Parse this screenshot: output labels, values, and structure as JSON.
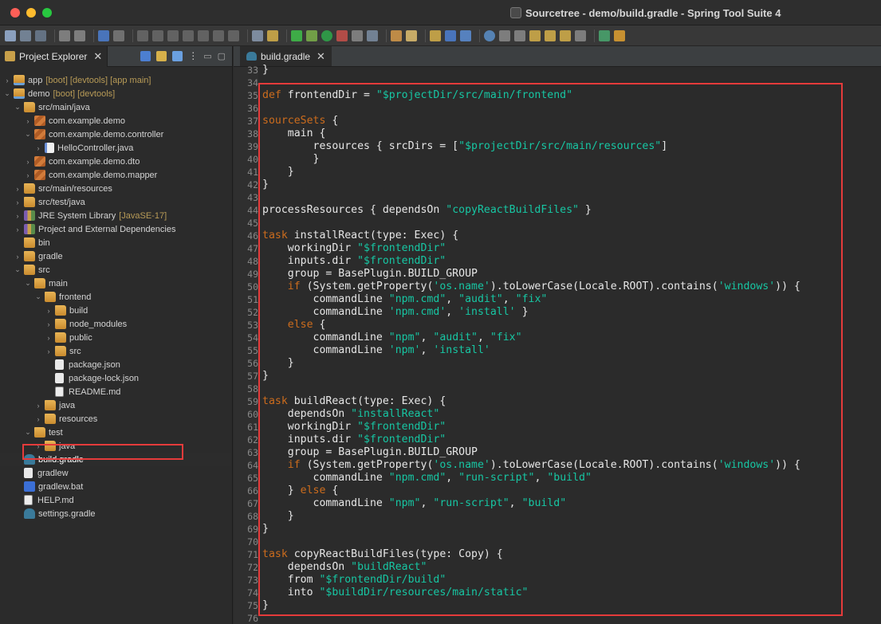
{
  "window": {
    "title": "Sourcetree - demo/build.gradle - Spring Tool Suite 4"
  },
  "project_explorer": {
    "tab_label": "Project Explorer",
    "close_symbol": "✕",
    "items": [
      {
        "name": "tree-item-app",
        "arrow": ">",
        "depth": 0,
        "icon": "proj",
        "label": "app",
        "decoration": "[boot] [devtools] [app main]"
      },
      {
        "name": "tree-item-demo",
        "arrow": "v",
        "depth": 0,
        "icon": "proj",
        "label": "demo",
        "decoration": "[boot] [devtools]"
      },
      {
        "name": "tree-item-src-main-java",
        "arrow": "v",
        "depth": 1,
        "icon": "folder",
        "label": "src/main/java",
        "decoration": ""
      },
      {
        "name": "tree-item-pkg-demo",
        "arrow": ">",
        "depth": 2,
        "icon": "pkg",
        "label": "com.example.demo",
        "decoration": ""
      },
      {
        "name": "tree-item-pkg-controller",
        "arrow": "v",
        "depth": 2,
        "icon": "pkg",
        "label": "com.example.demo.controller",
        "decoration": ""
      },
      {
        "name": "tree-item-hellocontroller",
        "arrow": ">",
        "depth": 3,
        "icon": "java",
        "label": "HelloController.java",
        "decoration": ""
      },
      {
        "name": "tree-item-pkg-dto",
        "arrow": ">",
        "depth": 2,
        "icon": "pkg",
        "label": "com.example.demo.dto",
        "decoration": ""
      },
      {
        "name": "tree-item-pkg-mapper",
        "arrow": ">",
        "depth": 2,
        "icon": "pkg",
        "label": "com.example.demo.mapper",
        "decoration": ""
      },
      {
        "name": "tree-item-src-main-resources",
        "arrow": ">",
        "depth": 1,
        "icon": "folder",
        "label": "src/main/resources",
        "decoration": ""
      },
      {
        "name": "tree-item-src-test-java",
        "arrow": ">",
        "depth": 1,
        "icon": "folder",
        "label": "src/test/java",
        "decoration": ""
      },
      {
        "name": "tree-item-jre",
        "arrow": ">",
        "depth": 1,
        "icon": "lib",
        "label": "JRE System Library",
        "decoration": "[JavaSE-17]"
      },
      {
        "name": "tree-item-deps",
        "arrow": ">",
        "depth": 1,
        "icon": "lib",
        "label": "Project and External Dependencies",
        "decoration": ""
      },
      {
        "name": "tree-item-bin",
        "arrow": "",
        "depth": 1,
        "icon": "folder",
        "label": "bin",
        "decoration": ""
      },
      {
        "name": "tree-item-gradle",
        "arrow": ">",
        "depth": 1,
        "icon": "folder",
        "label": "gradle",
        "decoration": ""
      },
      {
        "name": "tree-item-src",
        "arrow": "v",
        "depth": 1,
        "icon": "folder",
        "label": "src",
        "decoration": ""
      },
      {
        "name": "tree-item-main",
        "arrow": "v",
        "depth": 2,
        "icon": "folder",
        "label": "main",
        "decoration": ""
      },
      {
        "name": "tree-item-frontend",
        "arrow": "v",
        "depth": 3,
        "icon": "folder",
        "label": "frontend",
        "decoration": ""
      },
      {
        "name": "tree-item-build",
        "arrow": ">",
        "depth": 4,
        "icon": "folder",
        "label": "build",
        "decoration": ""
      },
      {
        "name": "tree-item-node-modules",
        "arrow": ">",
        "depth": 4,
        "icon": "folder",
        "label": "node_modules",
        "decoration": ""
      },
      {
        "name": "tree-item-public",
        "arrow": ">",
        "depth": 4,
        "icon": "folder",
        "label": "public",
        "decoration": ""
      },
      {
        "name": "tree-item-src-frontend",
        "arrow": ">",
        "depth": 4,
        "icon": "folder",
        "label": "src",
        "decoration": ""
      },
      {
        "name": "tree-item-package-json",
        "arrow": "",
        "depth": 4,
        "icon": "file",
        "label": "package.json",
        "decoration": ""
      },
      {
        "name": "tree-item-package-lock",
        "arrow": "",
        "depth": 4,
        "icon": "file",
        "label": "package-lock.json",
        "decoration": ""
      },
      {
        "name": "tree-item-readme",
        "arrow": "",
        "depth": 4,
        "icon": "md",
        "label": "README.md",
        "decoration": ""
      },
      {
        "name": "tree-item-java",
        "arrow": ">",
        "depth": 3,
        "icon": "folder",
        "label": "java",
        "decoration": ""
      },
      {
        "name": "tree-item-resources",
        "arrow": ">",
        "depth": 3,
        "icon": "folder",
        "label": "resources",
        "decoration": ""
      },
      {
        "name": "tree-item-test",
        "arrow": "v",
        "depth": 2,
        "icon": "folder",
        "label": "test",
        "decoration": ""
      },
      {
        "name": "tree-item-test-java",
        "arrow": ">",
        "depth": 3,
        "icon": "folder",
        "label": "java",
        "decoration": ""
      },
      {
        "name": "tree-item-build-gradle",
        "arrow": "",
        "depth": 1,
        "icon": "gradle",
        "label": "build.gradle",
        "decoration": "",
        "selected": true
      },
      {
        "name": "tree-item-gradlew",
        "arrow": "",
        "depth": 1,
        "icon": "file",
        "label": "gradlew",
        "decoration": ""
      },
      {
        "name": "tree-item-gradlew-bat",
        "arrow": "",
        "depth": 1,
        "icon": "bat",
        "label": "gradlew.bat",
        "decoration": ""
      },
      {
        "name": "tree-item-help",
        "arrow": "",
        "depth": 1,
        "icon": "md",
        "label": "HELP.md",
        "decoration": ""
      },
      {
        "name": "tree-item-settings-gradle",
        "arrow": "",
        "depth": 1,
        "icon": "gradle",
        "label": "settings.gradle",
        "decoration": ""
      }
    ]
  },
  "editor": {
    "tab_label": "build.gradle",
    "close_symbol": "✕",
    "lines": [
      {
        "n": "33",
        "t": "}"
      },
      {
        "n": "34",
        "t": ""
      },
      {
        "n": "35",
        "t": "[[def]] frontendDir = {{\"$projectDir/src/main/frontend\"}}"
      },
      {
        "n": "36",
        "t": ""
      },
      {
        "n": "37",
        "t": "[[sourceSets]] {"
      },
      {
        "n": "38",
        "t": "    main {"
      },
      {
        "n": "39",
        "t": "        resources { srcDirs = [{{\"$projectDir/src/main/resources\"}}]"
      },
      {
        "n": "40",
        "t": "        }"
      },
      {
        "n": "41",
        "t": "    }"
      },
      {
        "n": "42",
        "t": "}"
      },
      {
        "n": "43",
        "t": ""
      },
      {
        "n": "44",
        "t": "processResources { dependsOn {{\"copyReactBuildFiles\"}} }"
      },
      {
        "n": "45",
        "t": ""
      },
      {
        "n": "46",
        "t": "[[task]] installReact(type: Exec) {"
      },
      {
        "n": "47",
        "t": "    workingDir {{\"$frontendDir\"}}"
      },
      {
        "n": "48",
        "t": "    inputs.dir {{\"$frontendDir\"}}"
      },
      {
        "n": "49",
        "t": "    group = BasePlugin.BUILD_GROUP"
      },
      {
        "n": "50",
        "t": "    [[if]] (System.getProperty({{'os.name'}}).toLowerCase(Locale.ROOT).contains({{'windows'}})) {"
      },
      {
        "n": "51",
        "t": "        commandLine {{\"npm.cmd\"}}, {{\"audit\"}}, {{\"fix\"}}"
      },
      {
        "n": "52",
        "t": "        commandLine {{'npm.cmd'}}, {{'install'}} }"
      },
      {
        "n": "53",
        "t": "    [[else]] {"
      },
      {
        "n": "54",
        "t": "        commandLine {{\"npm\"}}, {{\"audit\"}}, {{\"fix\"}}"
      },
      {
        "n": "55",
        "t": "        commandLine {{'npm'}}, {{'install'}}"
      },
      {
        "n": "56",
        "t": "    }"
      },
      {
        "n": "57",
        "t": "}"
      },
      {
        "n": "58",
        "t": ""
      },
      {
        "n": "59",
        "t": "[[task]] buildReact(type: Exec) {"
      },
      {
        "n": "60",
        "t": "    dependsOn {{\"installReact\"}}"
      },
      {
        "n": "61",
        "t": "    workingDir {{\"$frontendDir\"}}"
      },
      {
        "n": "62",
        "t": "    inputs.dir {{\"$frontendDir\"}}"
      },
      {
        "n": "63",
        "t": "    group = BasePlugin.BUILD_GROUP"
      },
      {
        "n": "64",
        "t": "    [[if]] (System.getProperty({{'os.name'}}).toLowerCase(Locale.ROOT).contains({{'windows'}})) {"
      },
      {
        "n": "65",
        "t": "        commandLine {{\"npm.cmd\"}}, {{\"run-script\"}}, {{\"build\"}}"
      },
      {
        "n": "66",
        "t": "    } [[else]] {"
      },
      {
        "n": "67",
        "t": "        commandLine {{\"npm\"}}, {{\"run-script\"}}, {{\"build\"}}"
      },
      {
        "n": "68",
        "t": "    }"
      },
      {
        "n": "69",
        "t": "}"
      },
      {
        "n": "70",
        "t": ""
      },
      {
        "n": "71",
        "t": "[[task]] copyReactBuildFiles(type: Copy) {"
      },
      {
        "n": "72",
        "t": "    dependsOn {{\"buildReact\"}}"
      },
      {
        "n": "73",
        "t": "    from {{\"$frontendDir/build\"}}"
      },
      {
        "n": "74",
        "t": "    into {{\"$buildDir/resources/main/static\"}}"
      },
      {
        "n": "75",
        "t": "}"
      },
      {
        "n": "76",
        "t": ""
      }
    ]
  },
  "colors": {
    "keyword": "#cc6c1d",
    "string": "#17c6a3",
    "highlight_box": "#e53b3b"
  }
}
